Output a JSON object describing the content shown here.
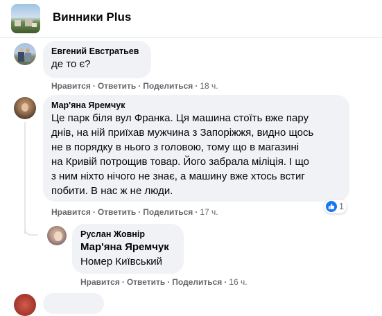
{
  "group": {
    "name": "Винники Plus"
  },
  "comments": [
    {
      "author": "Евгений Евстратьев",
      "text": "де то є?",
      "actions": {
        "like": "Нравится",
        "reply": "Ответить",
        "share": "Поделиться",
        "time": "18 ч."
      }
    },
    {
      "author": "Мар'яна Яремчук",
      "text": "Це парк біля вул Франка. Ця машина стоїть вже пару\nднів, на ній приїхав мужчина з Запоріжжя, видно щось\nне в порядку в нього з головою, тому що в магазині\nна Кривій потрощив товар. Його забрала міліція. І що\nз ним ніхто нічого не знає, а машину вже хтось встиг\nпобити. В нас ж не люди.",
      "reaction": {
        "icon": "like-icon",
        "count": "1"
      },
      "actions": {
        "like": "Нравится",
        "reply": "Ответить",
        "share": "Поделиться",
        "time": "17 ч."
      }
    },
    {
      "author": "Руслан Жовнір",
      "mention": "Мар'яна Яремчук",
      "text": "Номер Київський",
      "actions": {
        "like": "Нравится",
        "reply": "Ответить",
        "share": "Поделиться",
        "time": "16 ч."
      }
    }
  ],
  "colors": {
    "accent": "#1877f2",
    "bubble": "#f0f2f5",
    "meta": "#65676b"
  }
}
